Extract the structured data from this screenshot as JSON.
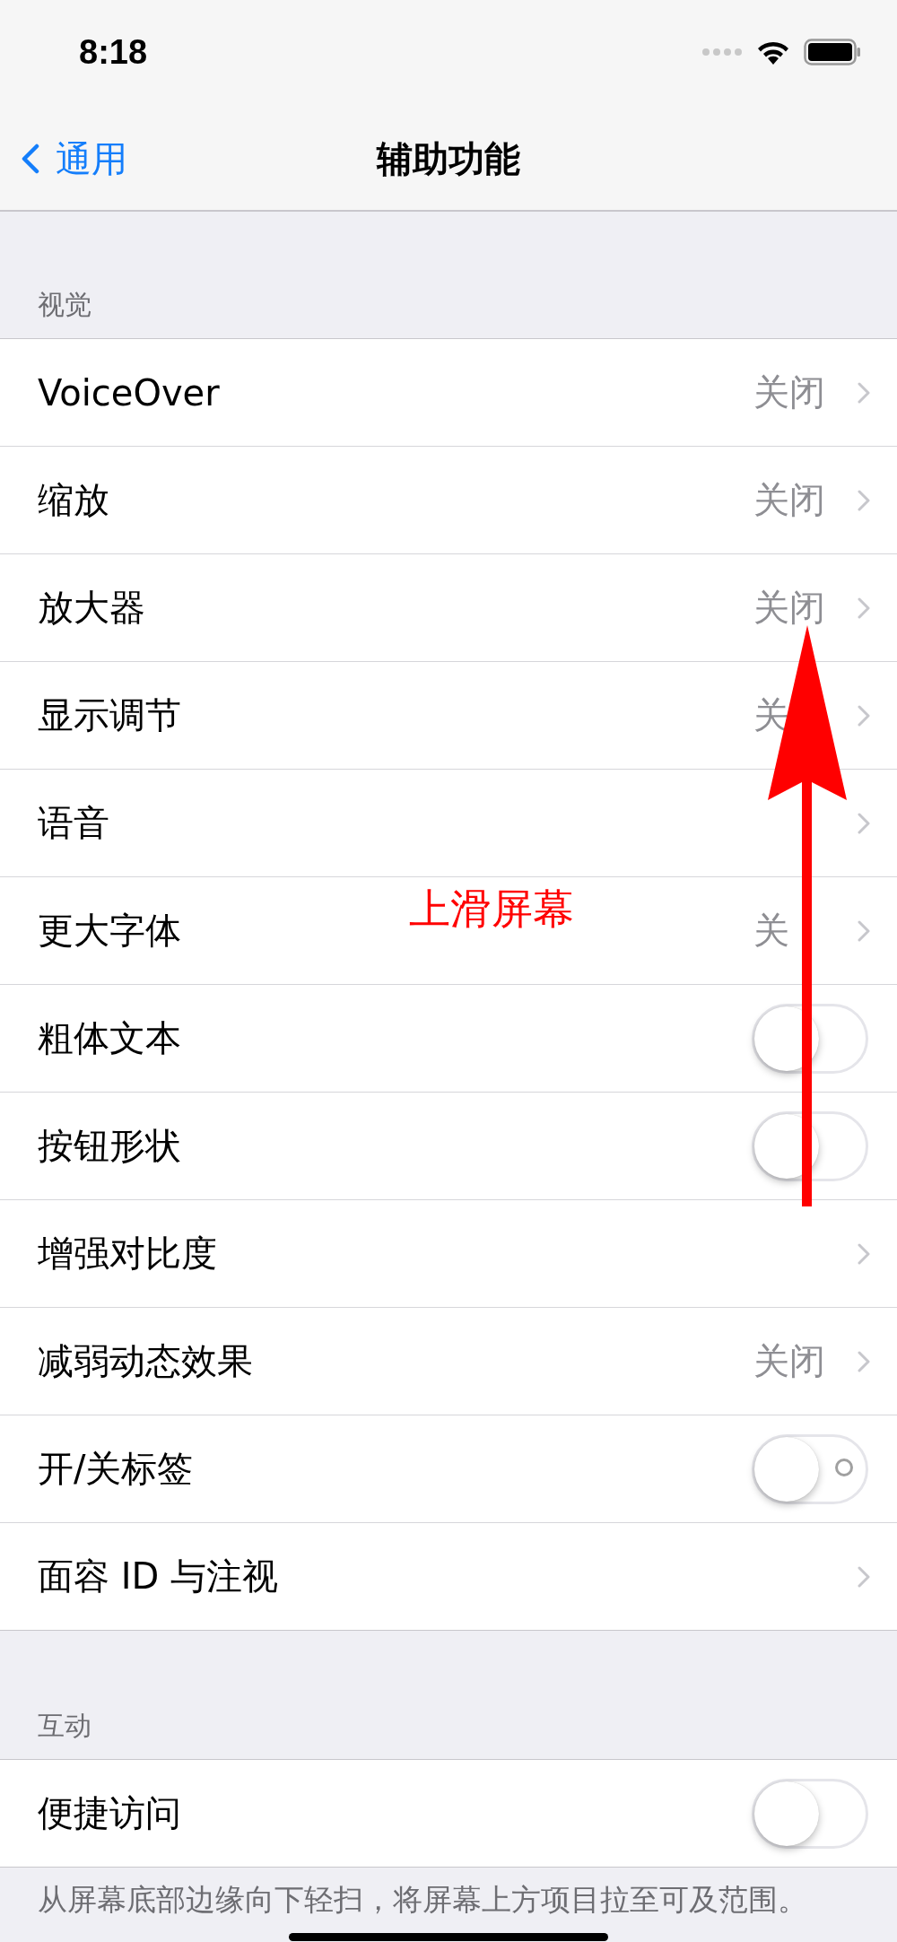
{
  "status_bar": {
    "time": "8:18"
  },
  "nav": {
    "back": "通用",
    "title": "辅助功能"
  },
  "sections": [
    {
      "header": "视觉",
      "rows": [
        {
          "kind": "disclosure",
          "label": "VoiceOver",
          "value": "关闭"
        },
        {
          "kind": "disclosure",
          "label": "缩放",
          "value": "关闭"
        },
        {
          "kind": "disclosure",
          "label": "放大器",
          "value": "关闭"
        },
        {
          "kind": "disclosure",
          "label": "显示调节",
          "value": "关"
        },
        {
          "kind": "disclosure",
          "label": "语音"
        },
        {
          "kind": "disclosure",
          "label": "更大字体",
          "value": "关"
        },
        {
          "kind": "toggle",
          "label": "粗体文本",
          "on": false,
          "on_off_labels": false
        },
        {
          "kind": "toggle",
          "label": "按钮形状",
          "on": false,
          "on_off_labels": false
        },
        {
          "kind": "disclosure",
          "label": "增强对比度"
        },
        {
          "kind": "disclosure",
          "label": "减弱动态效果",
          "value": "关闭"
        },
        {
          "kind": "toggle",
          "label": "开/关标签",
          "on": false,
          "on_off_labels": true
        },
        {
          "kind": "disclosure",
          "label": "面容 ID 与注视"
        }
      ]
    },
    {
      "header": "互动",
      "rows": [
        {
          "kind": "toggle",
          "label": "便捷访问",
          "on": false,
          "on_off_labels": false
        }
      ],
      "footer": "从屏幕底部边缘向下轻扫，将屏幕上方项目拉至可及范围。"
    }
  ],
  "annotation": {
    "text": "上滑屏幕"
  }
}
